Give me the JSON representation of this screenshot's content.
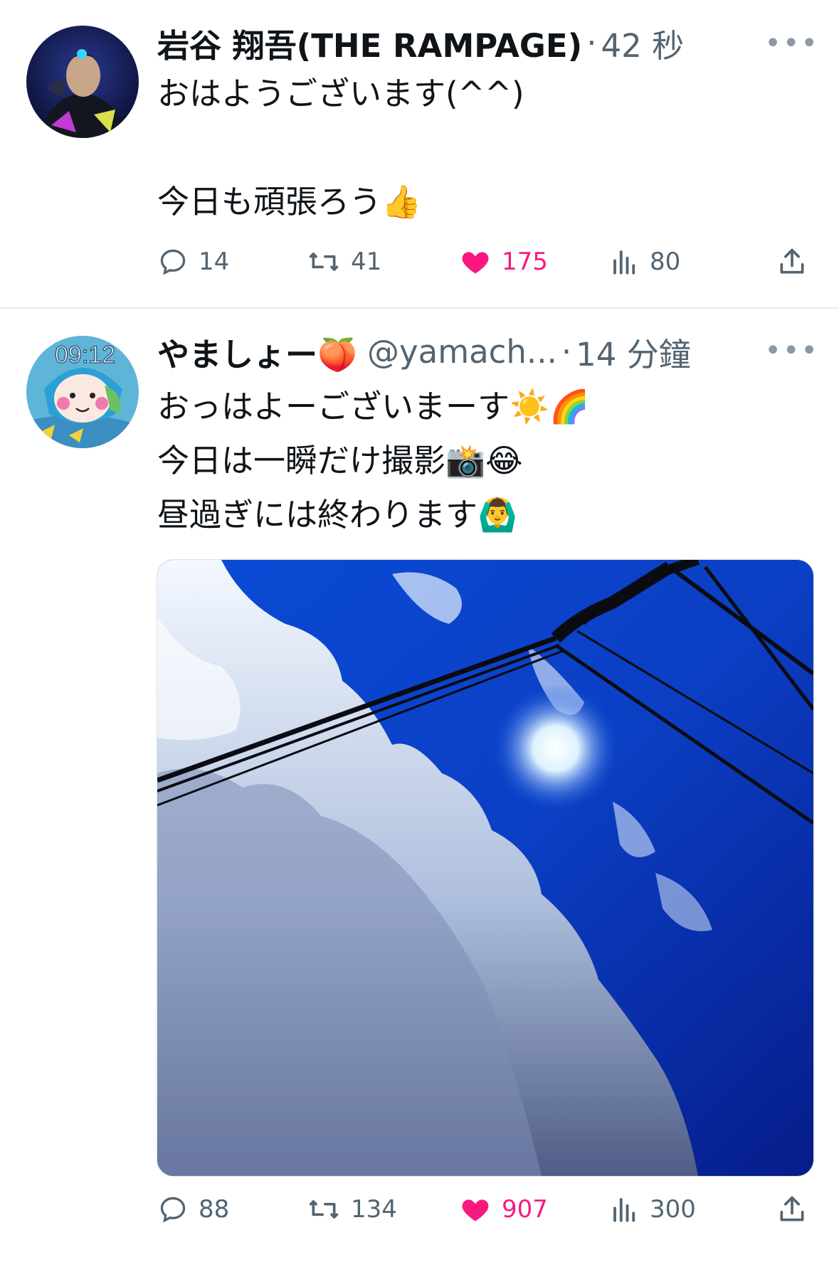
{
  "tweets": [
    {
      "display_name": "岩谷 翔吾(THE RAMPAGE)",
      "separator": "·",
      "time": "42 秒",
      "more": "•••",
      "text": "おはようございます(^^)\n\n今日も頑張ろう👍",
      "metrics": {
        "replies": "14",
        "retweets": "41",
        "likes": "175",
        "views": "80"
      },
      "liked": true
    },
    {
      "display_name": "やましょー🍑",
      "handle": "@yamach...",
      "separator": "·",
      "time": "14 分鐘",
      "more": "•••",
      "text": "おっはよーございまーす☀️🌈\n今日は一瞬だけ撮影📸😂\n昼過ぎには終わります🙆‍♂️",
      "avatar_clock": "09:12",
      "metrics": {
        "replies": "88",
        "retweets": "134",
        "likes": "907",
        "views": "300"
      },
      "liked": true
    }
  ],
  "colors": {
    "like": "#f91880",
    "muted": "#536471",
    "text": "#0f1419"
  }
}
